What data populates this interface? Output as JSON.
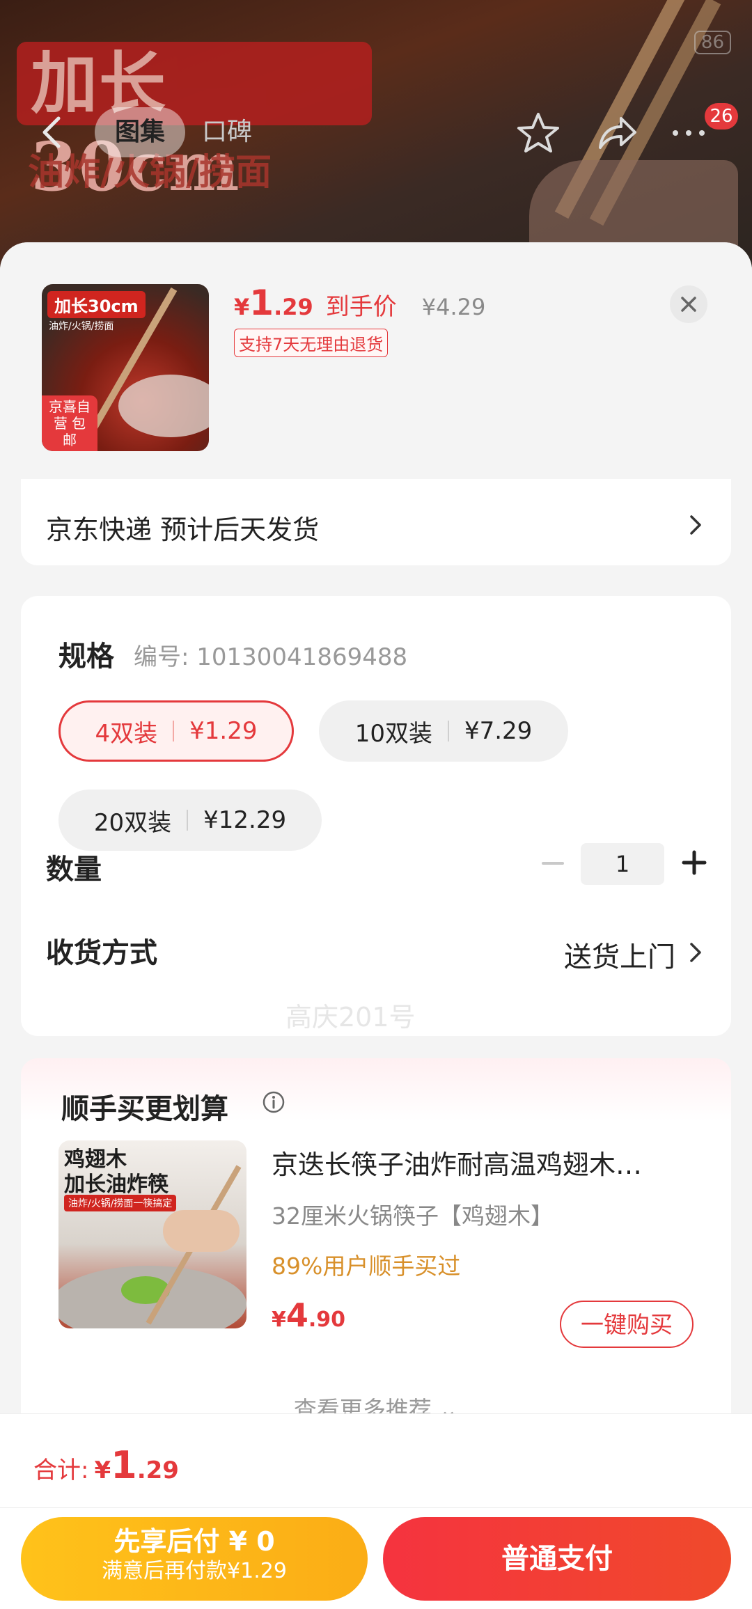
{
  "background": {
    "banner_text": "加长30cm",
    "banner_sub": "油炸/火锅/捞面",
    "status_battery": "86"
  },
  "nav": {
    "tabs": [
      "图集",
      "口碑"
    ],
    "cart_badge": "26",
    "icons": [
      "back-icon",
      "star-icon",
      "share-icon",
      "more-icon"
    ]
  },
  "product": {
    "thumb_title": "加长30cm",
    "thumb_sub": "油炸/火锅/捞面",
    "thumb_tag": "京喜自营 包邮",
    "price_currency": "¥",
    "price_int": "1",
    "price_dec": ".29",
    "price_label": "到手价",
    "original_price": "¥4.29",
    "return_tag": "支持7天无理由退货"
  },
  "shipping": {
    "text": "京东快递 预计后天发货"
  },
  "spec": {
    "title": "规格",
    "code": "编号: 10130041869488",
    "options": [
      {
        "name": "4双装",
        "price": "¥1.29",
        "selected": true
      },
      {
        "name": "10双装",
        "price": "¥7.29",
        "selected": false
      },
      {
        "name": "20双装",
        "price": "¥12.29",
        "selected": false
      }
    ],
    "quantity_label": "数量",
    "quantity": "1",
    "delivery_label": "收货方式",
    "delivery_value": "送货上门"
  },
  "watermark": "高庆201号",
  "recommend": {
    "title": "顺手买更划算",
    "image_text": "鸡翅木\n加长油炸筷",
    "image_tag": "油炸/火锅/捞面一筷搞定",
    "name": "京迭长筷子油炸耐高温鸡翅木…",
    "spec": "32厘米火锅筷子【鸡翅木】",
    "percent": "89%用户顺手买过",
    "price_currency": "¥",
    "price_int": "4",
    "price_dec": ".90",
    "buy_label": "一键购买",
    "more_label": "查看更多推荐 ⌄"
  },
  "footer": {
    "total_label": "合计:",
    "total_currency": "¥",
    "total_int": "1",
    "total_dec": ".29",
    "later_line1": "先享后付 ¥ 0",
    "later_line2": "满意后再付款¥1.29",
    "pay_label": "普通支付"
  },
  "colors": {
    "accent": "#e4393c",
    "gold": "#fbad16",
    "orange_text": "#d8902a"
  }
}
